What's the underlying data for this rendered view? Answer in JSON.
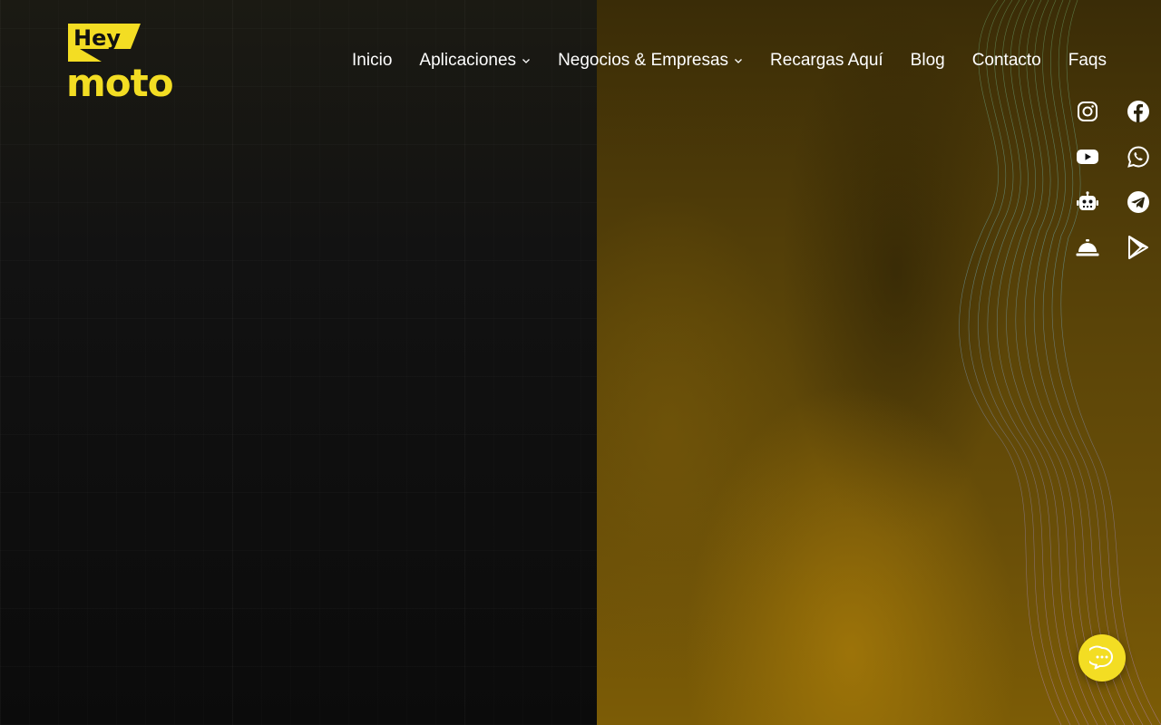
{
  "brand": {
    "logo_text_top": "Hey",
    "logo_text_bottom": "moto",
    "accent_color": "#f3dd23"
  },
  "nav": {
    "items": [
      {
        "label": "Inicio",
        "has_dropdown": false
      },
      {
        "label": "Aplicaciones",
        "has_dropdown": true
      },
      {
        "label": "Negocios & Empresas",
        "has_dropdown": true
      },
      {
        "label": "Recargas Aquí",
        "has_dropdown": false
      },
      {
        "label": "Blog",
        "has_dropdown": false
      },
      {
        "label": "Contacto",
        "has_dropdown": false
      },
      {
        "label": "Faqs",
        "has_dropdown": false
      }
    ]
  },
  "social": {
    "icons": [
      "instagram-icon",
      "facebook-icon",
      "youtube-icon",
      "whatsapp-icon",
      "robot-icon",
      "telegram-icon",
      "service-bell-icon",
      "google-play-icon"
    ]
  },
  "chat": {
    "icon": "chat-bubble-icon",
    "color": "#f3dd23"
  }
}
